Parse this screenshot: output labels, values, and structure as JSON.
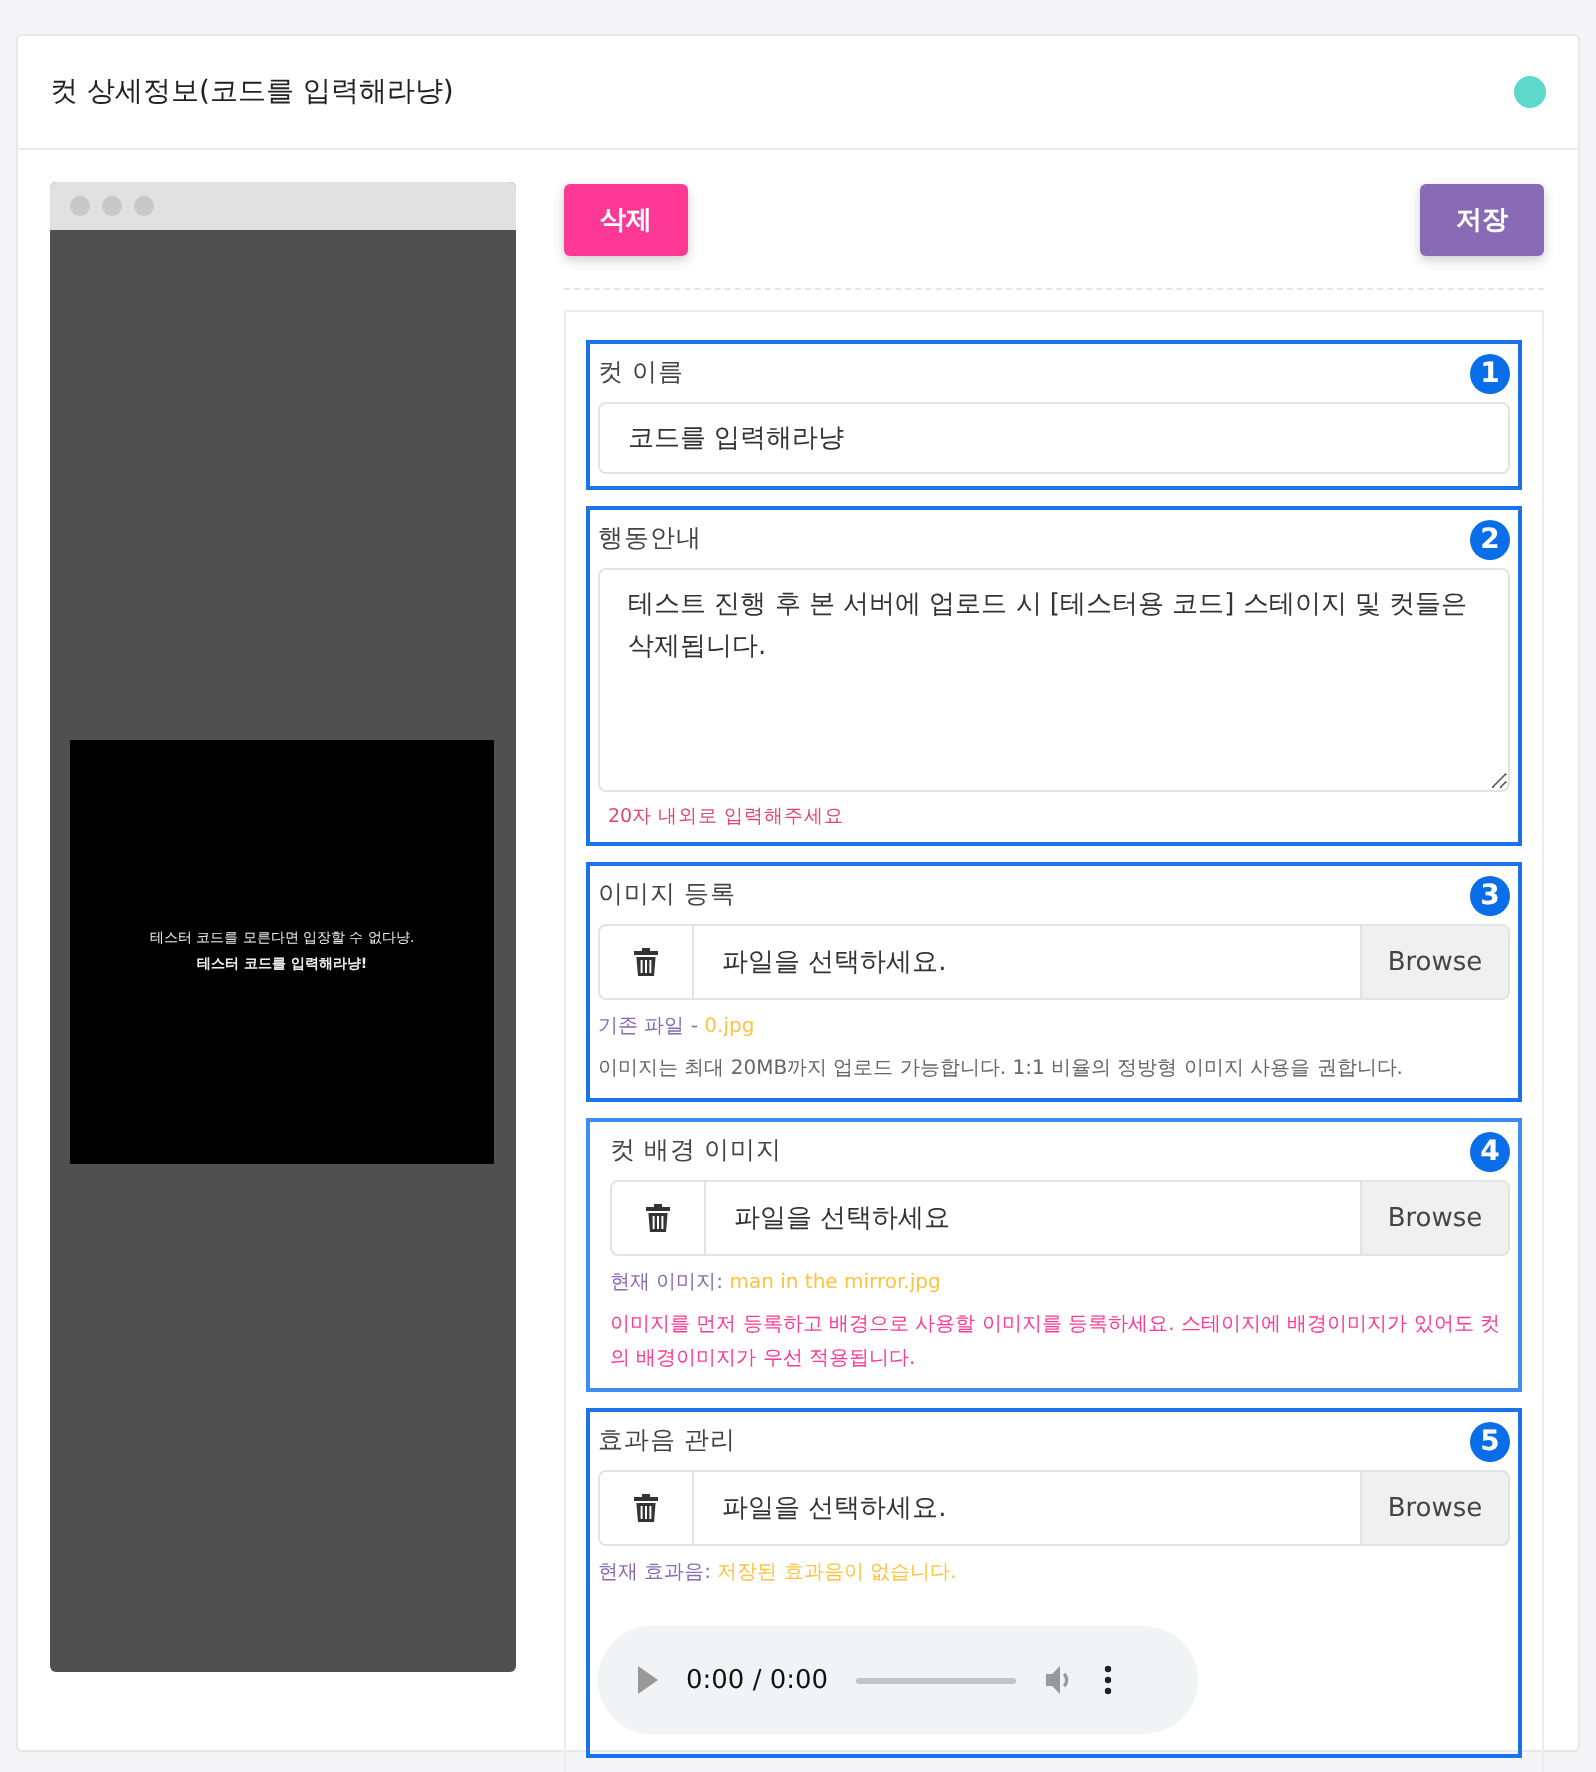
{
  "header": {
    "title": "컷 상세정보(코드를 입력해라냥)"
  },
  "preview": {
    "lines": [
      "테스터 코드를 모른다면 입장할 수 없다냥.",
      "테스터 코드를 입력해라냥!"
    ]
  },
  "buttons": {
    "delete": "삭제",
    "save": "저장"
  },
  "sections": [
    {
      "kind": "text",
      "badge": "1",
      "label": "컷 이름",
      "value": "코드를 입력해라냥"
    },
    {
      "kind": "textarea",
      "badge": "2",
      "label": "행동안내",
      "value": "테스트 진행 후 본 서버에 업로드 시 [테스터용 코드] 스테이지 및 컷들은 삭제됩니다.",
      "hint": "20자 내외로 입력해주세요"
    },
    {
      "kind": "file",
      "badge": "3",
      "label": "이미지 등록",
      "placeholder": "파일을 선택하세요.",
      "browse": "Browse",
      "info_label": "기존 파일 - ",
      "info_value": "0.jpg",
      "note": "이미지는 최대 20MB까지 업로드 가능합니다. 1:1 비율의 정방형 이미지 사용을 권합니다.",
      "note_warning": false
    },
    {
      "kind": "file",
      "badge": "4",
      "label": "컷 배경 이미지",
      "placeholder": "파일을 선택하세요",
      "browse": "Browse",
      "info_label": "현재 이미지: ",
      "info_value": "man in the mirror.jpg",
      "note": "이미지를 먼저 등록하고 배경으로 사용할 이미지를 등록하세요. 스테이지에 배경이미지가 있어도 컷의 배경이미지가 우선 적용됩니다.",
      "note_warning": true
    },
    {
      "kind": "audio",
      "badge": "5",
      "label": "효과음 관리",
      "placeholder": "파일을 선택하세요.",
      "browse": "Browse",
      "info_label": "현재 효과음: ",
      "info_value": "저장된 효과음이 없습니다.",
      "time": "0:00 / 0:00"
    }
  ]
}
